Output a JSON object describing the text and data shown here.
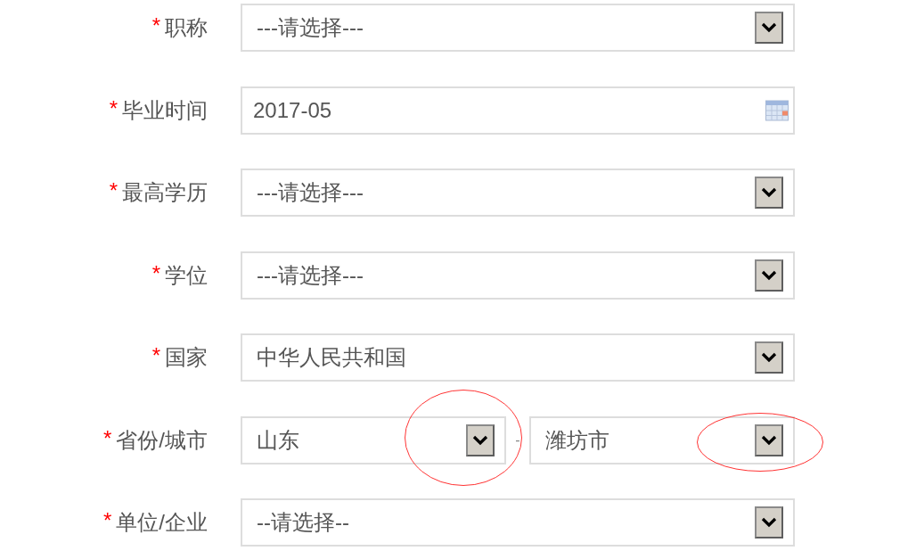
{
  "form": {
    "fields": [
      {
        "kind": "select",
        "required_mark": "*",
        "label": "职称",
        "value": "---请选择---"
      },
      {
        "kind": "date",
        "required_mark": "*",
        "label": "毕业时间",
        "value": "2017-05"
      },
      {
        "kind": "select",
        "required_mark": "*",
        "label": "最高学历",
        "value": "---请选择---"
      },
      {
        "kind": "select",
        "required_mark": "*",
        "label": "学位",
        "value": "---请选择---"
      },
      {
        "kind": "select",
        "required_mark": "*",
        "label": "国家",
        "value": "中华人民共和国"
      },
      {
        "kind": "select_pair",
        "required_mark": "*",
        "label": "省份/城市",
        "separator": "-",
        "selects": [
          {
            "value": "山东",
            "circled": true
          },
          {
            "value": "潍坊市",
            "circled": true
          }
        ]
      },
      {
        "kind": "select",
        "required_mark": "*",
        "label": "单位/企业",
        "value": "--请选择--"
      }
    ]
  }
}
